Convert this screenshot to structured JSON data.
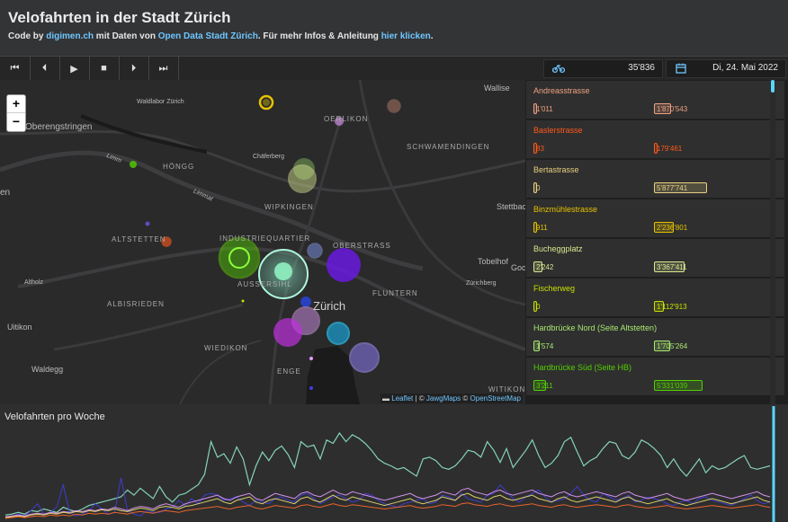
{
  "header": {
    "title": "Velofahrten in der Stadt Zürich",
    "subtitle": {
      "t1": "Code by ",
      "l1": "digimen.ch",
      "t2": " mit Daten von ",
      "l2": "Open Data Stadt Zürich",
      "t3": ". Für mehr Infos & Anleitung ",
      "l3": "hier klicken",
      "t4": "."
    }
  },
  "controls": {
    "buttons": [
      {
        "name": "skip-to-start-button",
        "icon": "skip-back-icon",
        "glyph": "⏮"
      },
      {
        "name": "step-back-button",
        "icon": "step-back-icon",
        "glyph": "⏴"
      },
      {
        "name": "play-button",
        "icon": "play-icon",
        "glyph": "▶"
      },
      {
        "name": "stop-button",
        "icon": "stop-icon",
        "glyph": "■"
      },
      {
        "name": "step-forward-button",
        "icon": "step-forward-icon",
        "glyph": "⏵"
      },
      {
        "name": "skip-to-end-button",
        "icon": "skip-forward-icon",
        "glyph": "⏭"
      }
    ],
    "total_rides": "35'836",
    "date": "Di, 24. Mai 2022",
    "rides_icon": "bicycle-icon",
    "date_icon": "calendar-icon"
  },
  "map": {
    "labels": {
      "oberengstringen": "Oberengstringen",
      "hoengg": "HÖNGG",
      "wipkingen": "WIPKINGEN",
      "altstetten": "ALTSTETTEN",
      "industriequartier": "INDUSTRIEQUARTIER",
      "oberstrass": "OBERSTRASS",
      "albisrieden": "ALBISRIEDEN",
      "aussersihl": "AUSSERSIHL",
      "fluntern": "FLUNTERN",
      "zurich": "Zürich",
      "wiedikon": "WIEDIKON",
      "enge": "ENGE",
      "witikon": "WITIKON",
      "schwamendingen": "SCHWAMENDINGEN",
      "oerlikon": "OERLIKON",
      "uitikon": "Uitikon",
      "waldegg": "Waldegg",
      "stettbach": "Stettbac",
      "tobelhof": "Tobelhof",
      "goc": "Goc",
      "waldlabor": "Waldlabor Zürich",
      "chaeferberg": "Chäferberg",
      "altholz": "Altholz",
      "zuerichberg": "Zürichberg",
      "wallisellen": "Wallise",
      "limmat1": "Limm",
      "limmat2": "Limmat",
      "edge_en": "en"
    },
    "zoom_in": "+",
    "zoom_out": "−",
    "attribution": {
      "leaflet": "Leaflet",
      "sep": " | © ",
      "jawg": "JawgMaps",
      "sep2": " © ",
      "osm": "OpenStreetMap"
    }
  },
  "stations": [
    {
      "name": "Andreasstrasse",
      "color": "#f0a080",
      "v1": "1'011",
      "v2": "1'870'543",
      "f1": 0.03,
      "f2": 0.12
    },
    {
      "name": "Baslerstrasse",
      "color": "#ff5a1a",
      "v1": "83",
      "v2": "179'461",
      "f1": 0.005,
      "f2": 0.02
    },
    {
      "name": "Bertastrasse",
      "color": "#e8d080",
      "v1": "0",
      "v2": "5'877'741",
      "f1": 0.0,
      "f2": 0.37
    },
    {
      "name": "Binzmühlestrasse",
      "color": "#e6c200",
      "v1": "911",
      "v2": "2'236'801",
      "f1": 0.03,
      "f2": 0.14
    },
    {
      "name": "Bucheggplatz",
      "color": "#d8e890",
      "v1": "2'242",
      "v2": "3'367'411",
      "f1": 0.07,
      "f2": 0.21
    },
    {
      "name": "Fischerweg",
      "color": "#c8e000",
      "v1": "0",
      "v2": "1'112'913",
      "f1": 0.0,
      "f2": 0.07
    },
    {
      "name": "Hardbrücke Nord (Seite Altstetten)",
      "color": "#a8e870",
      "v1": "1'574",
      "v2": "1'705'264",
      "f1": 0.05,
      "f2": 0.11
    },
    {
      "name": "Hardbrücke Süd (Seite HB)",
      "color": "#52d000",
      "v1": "3'211",
      "v2": "5'331'039",
      "f1": 0.1,
      "f2": 0.34
    }
  ],
  "chart": {
    "title": "Velofahrten pro Woche"
  },
  "chart_data": {
    "type": "line",
    "title": "Velofahrten pro Woche",
    "x_points": 120,
    "series": [
      {
        "color": "#8fe5c8",
        "values": [
          5,
          6,
          8,
          6,
          10,
          9,
          12,
          10,
          8,
          14,
          11,
          9,
          12,
          16,
          18,
          20,
          22,
          24,
          26,
          34,
          28,
          36,
          30,
          24,
          38,
          26,
          20,
          28,
          30,
          35,
          40,
          52,
          90,
          72,
          76,
          65,
          84,
          70,
          40,
          62,
          78,
          68,
          80,
          85,
          75,
          60,
          90,
          84,
          86,
          70,
          92,
          88,
          100,
          90,
          98,
          94,
          88,
          80,
          70,
          65,
          62,
          58,
          60,
          55,
          50,
          70,
          72,
          68,
          60,
          58,
          62,
          70,
          80,
          78,
          72,
          90,
          80,
          66,
          82,
          60,
          70,
          80,
          92,
          74,
          60,
          65,
          74,
          90,
          95,
          78,
          62,
          68,
          72,
          82,
          90,
          88,
          74,
          70,
          78,
          92,
          88,
          82,
          74,
          60,
          70,
          58,
          50,
          60,
          70,
          54,
          62,
          58,
          60,
          65,
          70,
          74,
          60,
          58,
          60,
          62
        ]
      },
      {
        "color": "#3f3fe0",
        "values": [
          2,
          3,
          6,
          4,
          10,
          18,
          6,
          8,
          14,
          40,
          8,
          4,
          6,
          10,
          18,
          12,
          6,
          8,
          48,
          10,
          6,
          4,
          10,
          8,
          8,
          12,
          14,
          22,
          16,
          24,
          18,
          28,
          30,
          28,
          22,
          24,
          26,
          20,
          16,
          22,
          20,
          18,
          24,
          26,
          22,
          20,
          28,
          30,
          24,
          18,
          22,
          26,
          28,
          24,
          20,
          22,
          30,
          28,
          22,
          18,
          16,
          14,
          18,
          20,
          22,
          24,
          18,
          20,
          28,
          26,
          22,
          30,
          24,
          22,
          20,
          28,
          30,
          40,
          32,
          24,
          20,
          26,
          30,
          34,
          26,
          20,
          22,
          24,
          30,
          38,
          28,
          22,
          20,
          30,
          26,
          22,
          24,
          28,
          20,
          22,
          26,
          24,
          22,
          18,
          16,
          20,
          22,
          18,
          24,
          26,
          22,
          20,
          18,
          16,
          20,
          24,
          28,
          22,
          18,
          20
        ]
      },
      {
        "color": "#e79cff",
        "values": [
          3,
          4,
          5,
          4,
          6,
          7,
          6,
          8,
          7,
          9,
          8,
          10,
          9,
          11,
          10,
          12,
          11,
          14,
          12,
          10,
          13,
          15,
          14,
          12,
          16,
          18,
          16,
          14,
          18,
          20,
          22,
          24,
          26,
          28,
          24,
          22,
          26,
          28,
          30,
          24,
          22,
          26,
          30,
          28,
          26,
          24,
          30,
          32,
          28,
          26,
          30,
          34,
          30,
          28,
          32,
          30,
          28,
          26,
          24,
          22,
          24,
          26,
          28,
          30,
          26,
          24,
          26,
          28,
          32,
          30,
          28,
          34,
          36,
          32,
          30,
          28,
          32,
          34,
          30,
          28,
          30,
          32,
          34,
          30,
          28,
          26,
          30,
          32,
          28,
          26,
          28,
          30,
          32,
          30,
          28,
          26,
          30,
          32,
          28,
          26,
          24,
          26,
          28,
          30,
          26,
          24,
          22,
          24,
          26,
          28,
          30,
          28,
          26,
          24,
          26,
          28,
          30,
          32,
          28,
          26
        ]
      },
      {
        "color": "#f0e070",
        "values": [
          2,
          3,
          4,
          3,
          5,
          6,
          5,
          7,
          6,
          8,
          7,
          9,
          8,
          10,
          9,
          11,
          10,
          12,
          10,
          9,
          11,
          13,
          12,
          10,
          14,
          15,
          14,
          12,
          15,
          16,
          18,
          20,
          22,
          24,
          20,
          18,
          22,
          24,
          26,
          20,
          18,
          22,
          24,
          22,
          20,
          18,
          24,
          26,
          22,
          20,
          24,
          28,
          24,
          22,
          26,
          24,
          22,
          20,
          18,
          16,
          18,
          20,
          22,
          24,
          20,
          18,
          20,
          22,
          26,
          24,
          22,
          28,
          30,
          26,
          24,
          22,
          26,
          28,
          24,
          22,
          24,
          26,
          28,
          24,
          22,
          20,
          24,
          26,
          22,
          20,
          22,
          24,
          26,
          24,
          22,
          20,
          24,
          26,
          22,
          20,
          18,
          20,
          22,
          24,
          20,
          18,
          16,
          18,
          20,
          22,
          24,
          22,
          20,
          18,
          20,
          22,
          24,
          26,
          22,
          20
        ]
      },
      {
        "color": "#ff6a2a",
        "values": [
          1,
          2,
          3,
          2,
          3,
          4,
          3,
          5,
          4,
          5,
          4,
          6,
          5,
          7,
          6,
          7,
          6,
          8,
          7,
          6,
          8,
          9,
          8,
          7,
          9,
          10,
          9,
          8,
          10,
          11,
          12,
          13,
          14,
          15,
          13,
          12,
          14,
          15,
          16,
          13,
          12,
          14,
          16,
          15,
          14,
          13,
          16,
          17,
          15,
          14,
          16,
          18,
          16,
          15,
          17,
          16,
          15,
          14,
          13,
          12,
          13,
          14,
          15,
          16,
          14,
          13,
          14,
          15,
          17,
          16,
          15,
          18,
          19,
          17,
          16,
          15,
          17,
          18,
          16,
          15,
          16,
          17,
          18,
          16,
          15,
          14,
          16,
          17,
          15,
          14,
          15,
          16,
          17,
          16,
          15,
          14,
          16,
          17,
          15,
          14,
          13,
          14,
          15,
          16,
          14,
          13,
          12,
          13,
          14,
          15,
          16,
          15,
          14,
          13,
          14,
          15,
          16,
          17,
          15,
          14
        ]
      }
    ]
  }
}
